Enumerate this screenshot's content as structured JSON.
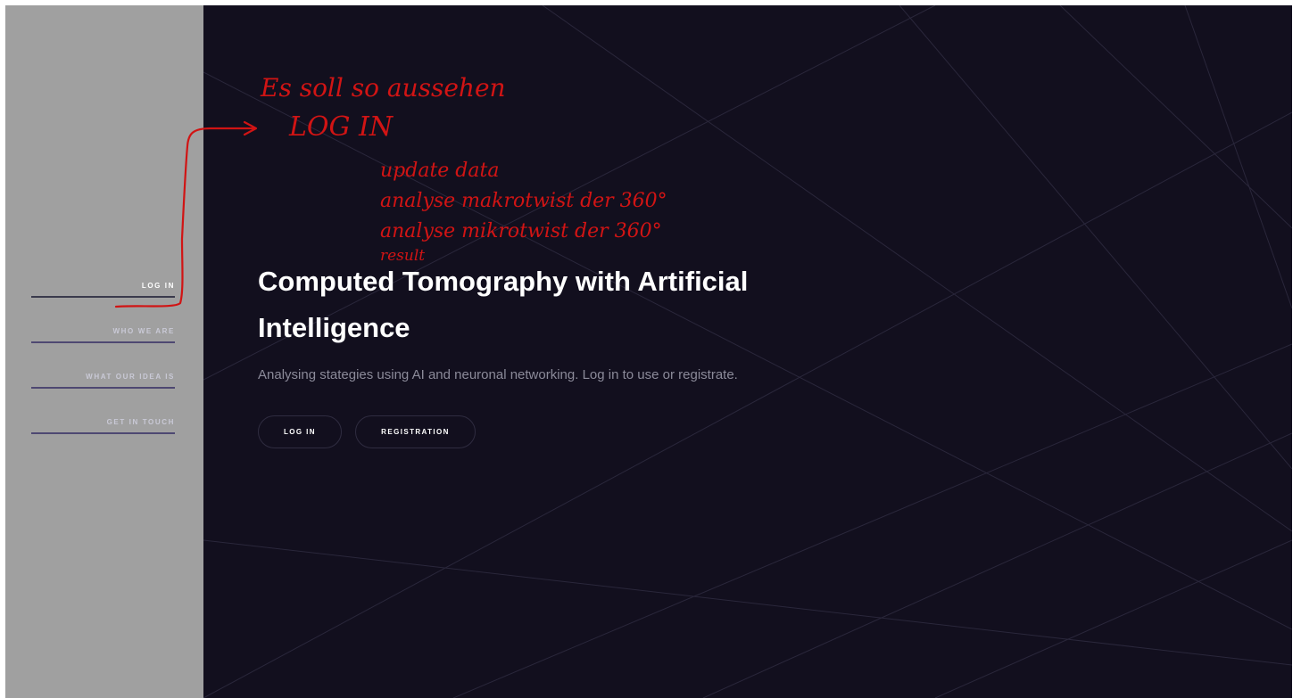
{
  "sidebar": {
    "items": [
      {
        "label": "LOG IN",
        "active": true
      },
      {
        "label": "WHO WE ARE",
        "active": false
      },
      {
        "label": "WHAT OUR IDEA IS",
        "active": false
      },
      {
        "label": "GET IN TOUCH",
        "active": false
      }
    ]
  },
  "hero": {
    "title": "Computed Tomography with Artificial Intelligence",
    "subtitle": "Analysing stategies using AI and neuronal networking. Log in to use or registrate.",
    "buttons": {
      "login_label": "LOG IN",
      "register_label": "REGISTRATION"
    }
  },
  "annotation": {
    "lines": [
      "Es soll so aussehen",
      "LOG IN",
      "update data",
      "analyse makrotwist der 360°",
      "analyse mikrotwist der 360°",
      "result"
    ]
  },
  "colors": {
    "sidebar_bg": "#a0a0a0",
    "main_bg": "#120f1e",
    "nav_underline": "#4e4872",
    "annotation_ink": "#d11414"
  }
}
